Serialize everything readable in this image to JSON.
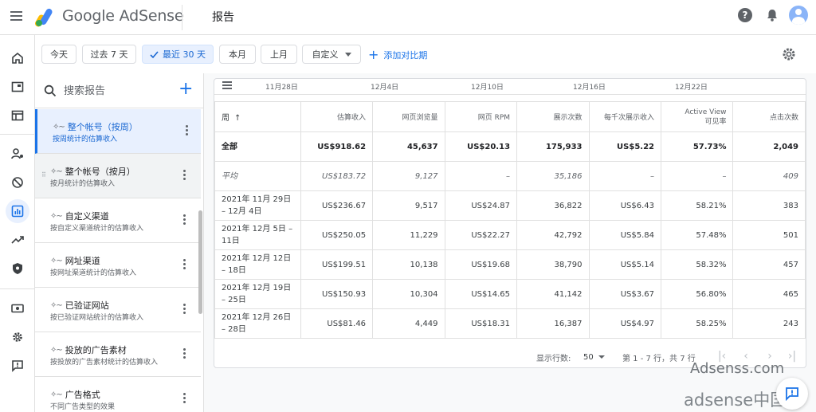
{
  "header": {
    "brand": "Google AdSense",
    "title": "报告",
    "help_glyph": "?"
  },
  "filters": {
    "chips": [
      {
        "label": "今天",
        "selected": false
      },
      {
        "label": "过去 7 天",
        "selected": false
      },
      {
        "label": "最近 30 天",
        "selected": true
      },
      {
        "label": "本月",
        "selected": false
      },
      {
        "label": "上月",
        "selected": false
      }
    ],
    "custom_label": "自定义",
    "add_compare": "添加对比期"
  },
  "panel": {
    "search_placeholder": "搜索报告",
    "items": [
      {
        "title": "整个帐号（按周）",
        "subtitle": "按周统计的估算收入",
        "state": "active"
      },
      {
        "title": "整个帐号（按月）",
        "subtitle": "按月统计的估算收入",
        "state": "hover"
      },
      {
        "title": "自定义渠道",
        "subtitle": "按自定义渠道统计的估算收入",
        "state": ""
      },
      {
        "title": "网址渠道",
        "subtitle": "按网址渠道统计的估算收入",
        "state": ""
      },
      {
        "title": "已验证网站",
        "subtitle": "按已验证网站统计的估算收入",
        "state": ""
      },
      {
        "title": "投放的广告素材",
        "subtitle": "按投放的广告素材统计的估算收入",
        "state": ""
      },
      {
        "title": "广告格式",
        "subtitle": "不同广告类型的效果",
        "state": ""
      }
    ]
  },
  "timeline": {
    "labels": [
      "11月28日",
      "12月4日",
      "12月10日",
      "12月16日",
      "12月22日"
    ]
  },
  "table": {
    "headers": [
      "周",
      "估算收入",
      "网页浏览量",
      "网页 RPM",
      "展示次数",
      "每千次展示收入",
      "Active View\n可见率",
      "点击次数"
    ],
    "sort_arrow": "↑",
    "total": [
      "全部",
      "US$918.62",
      "45,637",
      "US$20.13",
      "175,933",
      "US$5.22",
      "57.73%",
      "2,049"
    ],
    "average": [
      "平均",
      "US$183.72",
      "9,127",
      "–",
      "35,186",
      "–",
      "–",
      "409"
    ],
    "rows": [
      [
        "2021年 11月 29日 – 12月 4日",
        "US$236.67",
        "9,517",
        "US$24.87",
        "36,822",
        "US$6.43",
        "58.21%",
        "383"
      ],
      [
        "2021年 12月 5日 – 11日",
        "US$250.05",
        "11,229",
        "US$22.27",
        "42,792",
        "US$5.84",
        "57.48%",
        "501"
      ],
      [
        "2021年 12月 12日 – 18日",
        "US$199.51",
        "10,138",
        "US$19.68",
        "38,790",
        "US$5.14",
        "58.32%",
        "457"
      ],
      [
        "2021年 12月 19日 – 25日",
        "US$150.93",
        "10,304",
        "US$14.65",
        "41,142",
        "US$3.67",
        "56.80%",
        "465"
      ],
      [
        "2021年 12月 26日 – 28日",
        "US$81.46",
        "4,449",
        "US$18.31",
        "16,387",
        "US$4.97",
        "58.25%",
        "243"
      ]
    ]
  },
  "pager": {
    "rows_label": "显示行数:",
    "rows_value": "50",
    "range": "第 1 - 7 行，共 7 行"
  },
  "watermarks": [
    "Adsenss.com",
    "adsense中国"
  ],
  "colors": {
    "accent": "#1a73e8",
    "active_bg": "#e8f0fe"
  }
}
